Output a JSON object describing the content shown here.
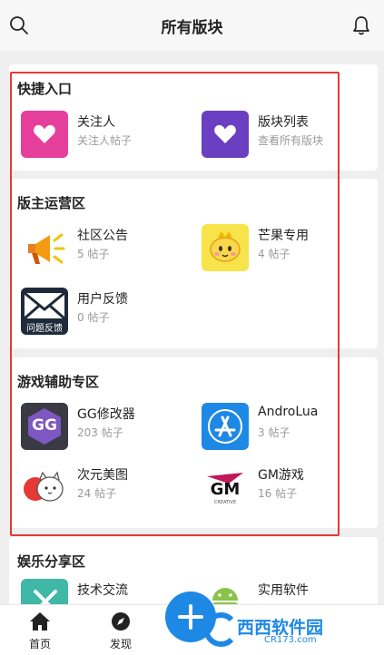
{
  "header": {
    "title": "所有版块"
  },
  "sections": [
    {
      "title": "快捷入口",
      "items": [
        {
          "name": "关注人",
          "sub": "关注人帖子",
          "icon": "heart-icon",
          "color": "#e53f9b"
        },
        {
          "name": "版块列表",
          "sub": "查看所有版块",
          "icon": "heart-icon",
          "color": "#6a3fc2"
        }
      ]
    },
    {
      "title": "版主运营区",
      "items": [
        {
          "name": "社区公告",
          "sub": "5 帖子",
          "icon": "megaphone-icon"
        },
        {
          "name": "芒果专用",
          "sub": "4 帖子",
          "icon": "mango-mascot-icon"
        },
        {
          "name": "用户反馈",
          "sub": "0 帖子",
          "icon": "feedback-envelope-icon",
          "badge": "问题反馈"
        }
      ]
    },
    {
      "title": "游戏辅助专区",
      "items": [
        {
          "name": "GG修改器",
          "sub": "203 帖子",
          "icon": "gg-logo-icon",
          "badge": "GG"
        },
        {
          "name": "AndroLua",
          "sub": "3 帖子",
          "icon": "app-store-icon"
        },
        {
          "name": "次元美图",
          "sub": "24 帖子",
          "icon": "anime-cat-icon"
        },
        {
          "name": "GM游戏",
          "sub": "16 帖子",
          "icon": "gm-logo-icon",
          "badge": "GM",
          "badge_sub": "CREATIVE"
        }
      ]
    },
    {
      "title": "娱乐分享区",
      "items": [
        {
          "name": "技术交流",
          "sub": "",
          "icon": "tech-icon"
        },
        {
          "name": "实用软件",
          "sub": "",
          "icon": "android-icon"
        }
      ]
    }
  ],
  "tabs": [
    {
      "label": "首页",
      "icon": "home-icon"
    },
    {
      "label": "发现",
      "icon": "compass-icon"
    }
  ],
  "watermark": {
    "text": "西西软件园",
    "domain": "CR173.com"
  },
  "colors": {
    "accent": "#1e88e5",
    "highlight_border": "#e53935"
  }
}
